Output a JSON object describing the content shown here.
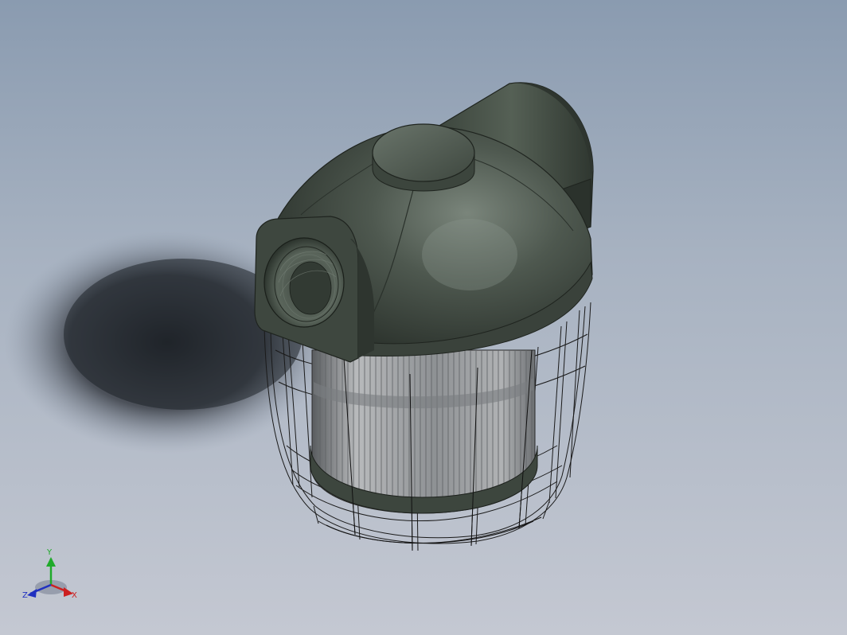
{
  "viewport": {
    "background_top": "#8a9bb0",
    "background_bottom": "#c4c8d2"
  },
  "model": {
    "body_color": "#3f4840",
    "body_highlight": "#6a746a",
    "wire_color": "#1a1a1a",
    "filter_color": "#9a9c9e"
  },
  "triad": {
    "y_label": "Y",
    "x_label": "X",
    "z_label": "Z",
    "y_color": "#1faa2a",
    "x_color": "#cc2020",
    "z_color": "#2030c0"
  }
}
